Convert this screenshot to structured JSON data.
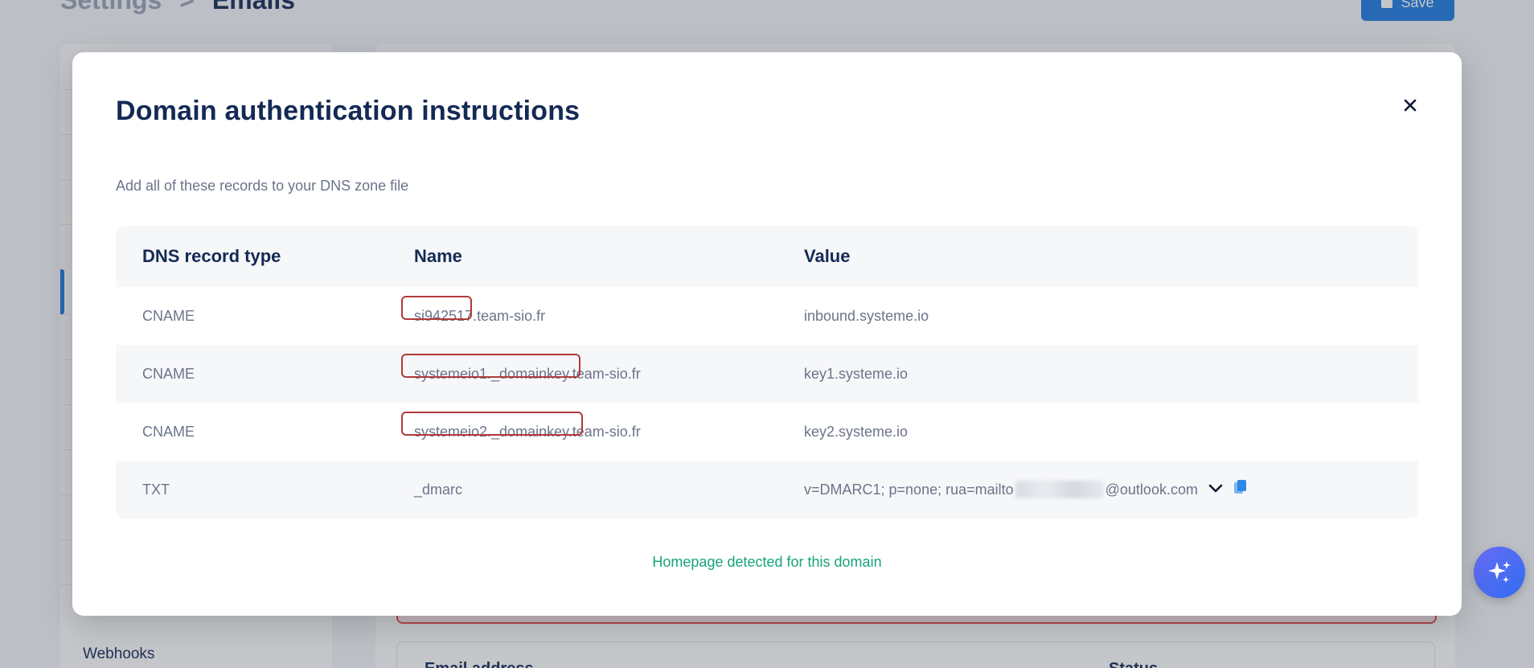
{
  "background": {
    "breadcrumb": {
      "parent": "Settings",
      "separator": ">",
      "current": "Emails"
    },
    "save_label": "Save",
    "sidebar_last_item": "Webhooks",
    "card_header_left": "Email address",
    "card_header_right": "Status"
  },
  "modal": {
    "title": "Domain authentication instructions",
    "subtitle": "Add all of these records to your DNS zone file",
    "table": {
      "headers": {
        "type": "DNS record type",
        "name": "Name",
        "value": "Value"
      },
      "rows": [
        {
          "type": "CNAME",
          "name_prefix": "si942517",
          "name_suffix": ".team-sio.fr",
          "value": "inbound.systeme.io"
        },
        {
          "type": "CNAME",
          "name_prefix": "systemeio1._domainkey",
          "name_suffix": ".team-sio.fr",
          "value": "key1.systeme.io"
        },
        {
          "type": "CNAME",
          "name_prefix": "systemeio2._domainkey",
          "name_suffix": ".team-sio.fr",
          "value": "key2.systeme.io"
        },
        {
          "type": "TXT",
          "name": "_dmarc",
          "value_prefix": "v=DMARC1; p=none; rua=mailto",
          "value_suffix": "@outlook.com"
        }
      ]
    },
    "homepage_status": "Homepage detected for this domain"
  },
  "colors": {
    "title": "#142a55",
    "highlight_box": "#b03a3a",
    "success_text": "#16a37a",
    "primary": "#1f7ae0"
  }
}
